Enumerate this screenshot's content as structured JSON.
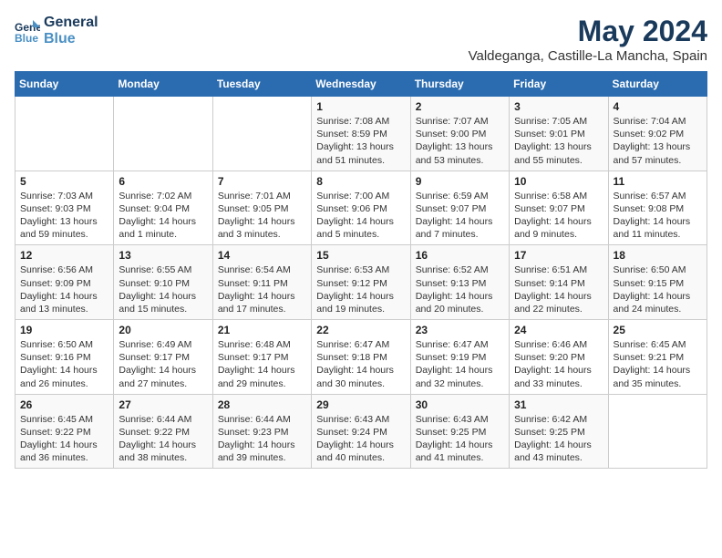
{
  "header": {
    "logo_line1": "General",
    "logo_line2": "Blue",
    "month": "May 2024",
    "location": "Valdeganga, Castille-La Mancha, Spain"
  },
  "weekdays": [
    "Sunday",
    "Monday",
    "Tuesday",
    "Wednesday",
    "Thursday",
    "Friday",
    "Saturday"
  ],
  "weeks": [
    [
      {
        "day": "",
        "sunrise": "",
        "sunset": "",
        "daylight": ""
      },
      {
        "day": "",
        "sunrise": "",
        "sunset": "",
        "daylight": ""
      },
      {
        "day": "",
        "sunrise": "",
        "sunset": "",
        "daylight": ""
      },
      {
        "day": "1",
        "sunrise": "Sunrise: 7:08 AM",
        "sunset": "Sunset: 8:59 PM",
        "daylight": "Daylight: 13 hours and 51 minutes."
      },
      {
        "day": "2",
        "sunrise": "Sunrise: 7:07 AM",
        "sunset": "Sunset: 9:00 PM",
        "daylight": "Daylight: 13 hours and 53 minutes."
      },
      {
        "day": "3",
        "sunrise": "Sunrise: 7:05 AM",
        "sunset": "Sunset: 9:01 PM",
        "daylight": "Daylight: 13 hours and 55 minutes."
      },
      {
        "day": "4",
        "sunrise": "Sunrise: 7:04 AM",
        "sunset": "Sunset: 9:02 PM",
        "daylight": "Daylight: 13 hours and 57 minutes."
      }
    ],
    [
      {
        "day": "5",
        "sunrise": "Sunrise: 7:03 AM",
        "sunset": "Sunset: 9:03 PM",
        "daylight": "Daylight: 13 hours and 59 minutes."
      },
      {
        "day": "6",
        "sunrise": "Sunrise: 7:02 AM",
        "sunset": "Sunset: 9:04 PM",
        "daylight": "Daylight: 14 hours and 1 minute."
      },
      {
        "day": "7",
        "sunrise": "Sunrise: 7:01 AM",
        "sunset": "Sunset: 9:05 PM",
        "daylight": "Daylight: 14 hours and 3 minutes."
      },
      {
        "day": "8",
        "sunrise": "Sunrise: 7:00 AM",
        "sunset": "Sunset: 9:06 PM",
        "daylight": "Daylight: 14 hours and 5 minutes."
      },
      {
        "day": "9",
        "sunrise": "Sunrise: 6:59 AM",
        "sunset": "Sunset: 9:07 PM",
        "daylight": "Daylight: 14 hours and 7 minutes."
      },
      {
        "day": "10",
        "sunrise": "Sunrise: 6:58 AM",
        "sunset": "Sunset: 9:07 PM",
        "daylight": "Daylight: 14 hours and 9 minutes."
      },
      {
        "day": "11",
        "sunrise": "Sunrise: 6:57 AM",
        "sunset": "Sunset: 9:08 PM",
        "daylight": "Daylight: 14 hours and 11 minutes."
      }
    ],
    [
      {
        "day": "12",
        "sunrise": "Sunrise: 6:56 AM",
        "sunset": "Sunset: 9:09 PM",
        "daylight": "Daylight: 14 hours and 13 minutes."
      },
      {
        "day": "13",
        "sunrise": "Sunrise: 6:55 AM",
        "sunset": "Sunset: 9:10 PM",
        "daylight": "Daylight: 14 hours and 15 minutes."
      },
      {
        "day": "14",
        "sunrise": "Sunrise: 6:54 AM",
        "sunset": "Sunset: 9:11 PM",
        "daylight": "Daylight: 14 hours and 17 minutes."
      },
      {
        "day": "15",
        "sunrise": "Sunrise: 6:53 AM",
        "sunset": "Sunset: 9:12 PM",
        "daylight": "Daylight: 14 hours and 19 minutes."
      },
      {
        "day": "16",
        "sunrise": "Sunrise: 6:52 AM",
        "sunset": "Sunset: 9:13 PM",
        "daylight": "Daylight: 14 hours and 20 minutes."
      },
      {
        "day": "17",
        "sunrise": "Sunrise: 6:51 AM",
        "sunset": "Sunset: 9:14 PM",
        "daylight": "Daylight: 14 hours and 22 minutes."
      },
      {
        "day": "18",
        "sunrise": "Sunrise: 6:50 AM",
        "sunset": "Sunset: 9:15 PM",
        "daylight": "Daylight: 14 hours and 24 minutes."
      }
    ],
    [
      {
        "day": "19",
        "sunrise": "Sunrise: 6:50 AM",
        "sunset": "Sunset: 9:16 PM",
        "daylight": "Daylight: 14 hours and 26 minutes."
      },
      {
        "day": "20",
        "sunrise": "Sunrise: 6:49 AM",
        "sunset": "Sunset: 9:17 PM",
        "daylight": "Daylight: 14 hours and 27 minutes."
      },
      {
        "day": "21",
        "sunrise": "Sunrise: 6:48 AM",
        "sunset": "Sunset: 9:17 PM",
        "daylight": "Daylight: 14 hours and 29 minutes."
      },
      {
        "day": "22",
        "sunrise": "Sunrise: 6:47 AM",
        "sunset": "Sunset: 9:18 PM",
        "daylight": "Daylight: 14 hours and 30 minutes."
      },
      {
        "day": "23",
        "sunrise": "Sunrise: 6:47 AM",
        "sunset": "Sunset: 9:19 PM",
        "daylight": "Daylight: 14 hours and 32 minutes."
      },
      {
        "day": "24",
        "sunrise": "Sunrise: 6:46 AM",
        "sunset": "Sunset: 9:20 PM",
        "daylight": "Daylight: 14 hours and 33 minutes."
      },
      {
        "day": "25",
        "sunrise": "Sunrise: 6:45 AM",
        "sunset": "Sunset: 9:21 PM",
        "daylight": "Daylight: 14 hours and 35 minutes."
      }
    ],
    [
      {
        "day": "26",
        "sunrise": "Sunrise: 6:45 AM",
        "sunset": "Sunset: 9:22 PM",
        "daylight": "Daylight: 14 hours and 36 minutes."
      },
      {
        "day": "27",
        "sunrise": "Sunrise: 6:44 AM",
        "sunset": "Sunset: 9:22 PM",
        "daylight": "Daylight: 14 hours and 38 minutes."
      },
      {
        "day": "28",
        "sunrise": "Sunrise: 6:44 AM",
        "sunset": "Sunset: 9:23 PM",
        "daylight": "Daylight: 14 hours and 39 minutes."
      },
      {
        "day": "29",
        "sunrise": "Sunrise: 6:43 AM",
        "sunset": "Sunset: 9:24 PM",
        "daylight": "Daylight: 14 hours and 40 minutes."
      },
      {
        "day": "30",
        "sunrise": "Sunrise: 6:43 AM",
        "sunset": "Sunset: 9:25 PM",
        "daylight": "Daylight: 14 hours and 41 minutes."
      },
      {
        "day": "31",
        "sunrise": "Sunrise: 6:42 AM",
        "sunset": "Sunset: 9:25 PM",
        "daylight": "Daylight: 14 hours and 43 minutes."
      },
      {
        "day": "",
        "sunrise": "",
        "sunset": "",
        "daylight": ""
      }
    ]
  ]
}
